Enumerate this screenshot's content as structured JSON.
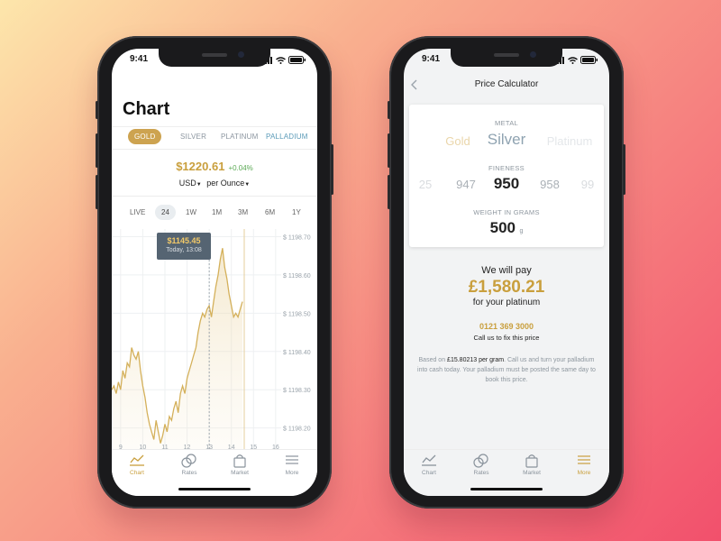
{
  "chart_screen": {
    "time": "9:41",
    "title": "Chart",
    "metals": [
      "GOLD",
      "SILVER",
      "PLATINUM",
      "PALLADIUM"
    ],
    "active_metal": "GOLD",
    "price": "$1220.61",
    "change": "+0.04%",
    "currency": "USD",
    "unit": "per Ounce",
    "ranges": [
      "LIVE",
      "24",
      "1W",
      "1M",
      "3M",
      "6M",
      "1Y"
    ],
    "active_range": "24",
    "tooltip": {
      "value": "$1145.45",
      "time": "Today, 13:08"
    }
  },
  "chart_data": {
    "type": "area",
    "title": "",
    "xlabel": "",
    "ylabel": "",
    "x_ticks": [
      "9",
      "10",
      "11",
      "12",
      "13",
      "14",
      "15",
      "16"
    ],
    "y_ticks": [
      "$ 1198.70",
      "$ 1198.60",
      "$ 1198.50",
      "$ 1198.40",
      "$ 1198.30",
      "$ 1198.20"
    ],
    "ylim": [
      1198.145,
      1198.72
    ],
    "xlim": [
      8.6,
      16.25
    ],
    "grid": true,
    "line_color": "#d4b05a",
    "series": [
      {
        "x": [
          8.6,
          8.7,
          8.8,
          8.9,
          9.0,
          9.1,
          9.2,
          9.3,
          9.4,
          9.5,
          9.6,
          9.7,
          9.8,
          9.9,
          10.0,
          10.1,
          10.2,
          10.3,
          10.4,
          10.5,
          10.6,
          10.7,
          10.8,
          10.9,
          11.0,
          11.1,
          11.2,
          11.3,
          11.4,
          11.5,
          11.6,
          11.7,
          11.8,
          11.9,
          12.0,
          12.1,
          12.2,
          12.3,
          12.4,
          12.5,
          12.6,
          12.7,
          12.8,
          12.9,
          13.0,
          13.1,
          13.2,
          13.3,
          13.4,
          13.5,
          13.6,
          13.7,
          13.8,
          13.9,
          14.0,
          14.1,
          14.2,
          14.3,
          14.4,
          14.5
        ],
        "y": [
          1198.3,
          1198.31,
          1198.29,
          1198.32,
          1198.3,
          1198.35,
          1198.33,
          1198.37,
          1198.36,
          1198.41,
          1198.39,
          1198.38,
          1198.4,
          1198.35,
          1198.31,
          1198.28,
          1198.24,
          1198.21,
          1198.19,
          1198.17,
          1198.22,
          1198.19,
          1198.16,
          1198.18,
          1198.21,
          1198.19,
          1198.23,
          1198.22,
          1198.25,
          1198.27,
          1198.24,
          1198.29,
          1198.31,
          1198.29,
          1198.33,
          1198.35,
          1198.37,
          1198.39,
          1198.41,
          1198.45,
          1198.48,
          1198.5,
          1198.49,
          1198.51,
          1198.52,
          1198.49,
          1198.53,
          1198.57,
          1198.6,
          1198.64,
          1198.67,
          1198.62,
          1198.59,
          1198.55,
          1198.52,
          1198.49,
          1198.5,
          1198.49,
          1198.51,
          1198.53
        ]
      }
    ]
  },
  "calculator_screen": {
    "time": "9:41",
    "nav_title": "Price Calculator",
    "metal_label": "METAL",
    "metal_options": [
      "Gold",
      "Silver",
      "Platinum"
    ],
    "fineness_label": "FINENESS",
    "fineness_options": [
      "25",
      "947",
      "950",
      "958",
      "99"
    ],
    "weight_label": "WEIGHT IN GRAMS",
    "weight_value": "500",
    "weight_unit": "g",
    "we_will_pay": "We will pay",
    "amount": "£1,580.21",
    "for_text": "for your platinum",
    "phone": "0121 369 3000",
    "call_text": "Call us  to fix this price",
    "disclaimer_prefix": "Based on ",
    "disclaimer_rate": "£15.80213 per gram",
    "disclaimer_rest": ". Call us and turn your palladium into cash today. Your palladium must be posted the same day to book this price."
  },
  "tabs": [
    "Chart",
    "Rates",
    "Market",
    "More"
  ],
  "colors": {
    "accent_gold": "#c99f3d",
    "positive": "#5caa56",
    "tooltip_bg": "#556472"
  }
}
